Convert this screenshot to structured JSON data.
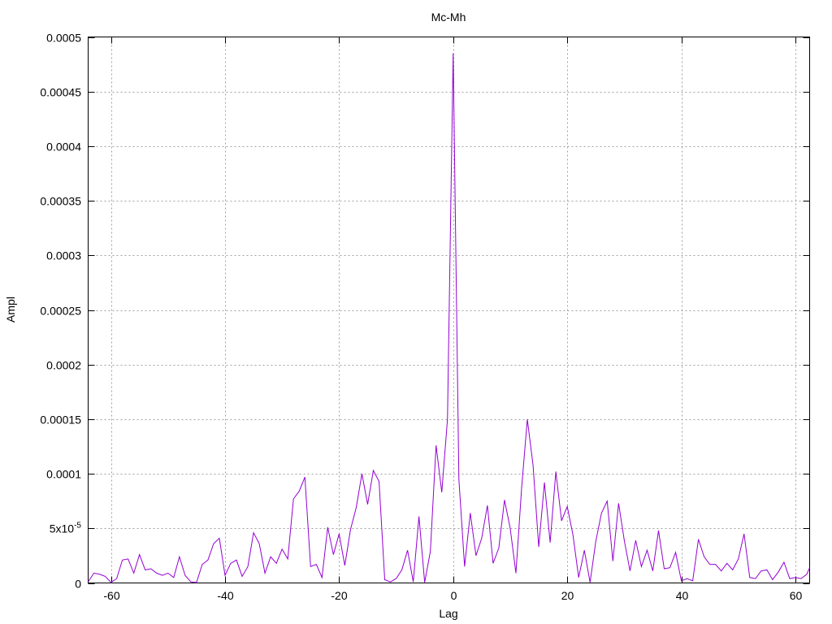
{
  "chart_data": {
    "type": "line",
    "title": "Mc-Mh",
    "xlabel": "Lag",
    "ylabel": "Ampl",
    "xlim": [
      -64,
      62.5
    ],
    "ylim": [
      0,
      0.0005
    ],
    "grid": true,
    "x_ticks": [
      -60,
      -40,
      -20,
      0,
      20,
      40,
      60
    ],
    "x_tick_labels": [
      "-60",
      "-40",
      "-20",
      "0",
      "20",
      "40",
      "60"
    ],
    "y_ticks": [
      0,
      5e-05,
      0.0001,
      0.00015,
      0.0002,
      0.00025,
      0.0003,
      0.00035,
      0.0004,
      0.00045,
      0.0005
    ],
    "y_tick_labels": [
      "0",
      "5x10",
      "0.0001",
      "0.00015",
      "0.0002",
      "0.00025",
      "0.0003",
      "0.00035",
      "0.0004",
      "0.00045",
      "0.0005"
    ],
    "y_tick_exponent": "-5",
    "line_color": "#9400d3",
    "series": [
      {
        "x": [
          -64,
          -63,
          -62,
          -61,
          -60,
          -59,
          -58,
          -57,
          -56,
          -55,
          -54,
          -53,
          -52,
          -51,
          -50,
          -49,
          -48,
          -47,
          -46,
          -45,
          -44,
          -43,
          -42,
          -41,
          -40,
          -39,
          -38,
          -37,
          -36,
          -35,
          -34,
          -33,
          -32,
          -31,
          -30,
          -29,
          -28,
          -27,
          -26,
          -25,
          -24,
          -23,
          -22,
          -21,
          -20,
          -19,
          -18,
          -17,
          -16,
          -15,
          -14,
          -13,
          -12,
          -11,
          -10,
          -9,
          -8,
          -7,
          -6,
          -5,
          -4,
          -3,
          -2,
          -1,
          0,
          1,
          2,
          3,
          4,
          5,
          6,
          7,
          8,
          9,
          10,
          11,
          12,
          13,
          14,
          15,
          16,
          17,
          18,
          19,
          20,
          21,
          22,
          23,
          24,
          25,
          26,
          27,
          28,
          29,
          30,
          31,
          32,
          33,
          34,
          35,
          36,
          37,
          38,
          39,
          40,
          41,
          42,
          43,
          44,
          45,
          46,
          47,
          48,
          49,
          50,
          51,
          52,
          53,
          54,
          55,
          56,
          57,
          58,
          59,
          60,
          61,
          62,
          62.5
        ],
        "y": [
          1e-06,
          9e-06,
          8e-06,
          6e-06,
          5e-07,
          4e-06,
          2.1e-05,
          2.2e-05,
          9e-06,
          2.6e-05,
          1.2e-05,
          1.3e-05,
          9e-06,
          7e-06,
          9e-06,
          5e-06,
          2.4e-05,
          7e-06,
          1e-06,
          5e-07,
          1.7e-05,
          2.1e-05,
          3.6e-05,
          4.1e-05,
          7e-06,
          1.8e-05,
          2.1e-05,
          6e-06,
          1.5e-05,
          4.6e-05,
          3.6e-05,
          9e-06,
          2.4e-05,
          1.8e-05,
          3.1e-05,
          2.2e-05,
          7.7e-05,
          8.4e-05,
          9.7e-05,
          1.5e-05,
          1.7e-05,
          5e-06,
          5.1e-05,
          2.6e-05,
          4.5e-05,
          1.6e-05,
          4.9e-05,
          6.9e-05,
          0.0001,
          7.2e-05,
          0.000103,
          9.3e-05,
          3e-06,
          1e-06,
          4e-06,
          1.2e-05,
          3e-05,
          1e-06,
          6.1e-05,
          5e-07,
          2.9e-05,
          0.000126,
          8.3e-05,
          0.00015,
          0.000485,
          9.5e-05,
          1.5e-05,
          6.4e-05,
          2.5e-05,
          4.1e-05,
          7.1e-05,
          1.8e-05,
          3.2e-05,
          7.6e-05,
          5e-05,
          9e-06,
          8.7e-05,
          0.00015,
          0.000108,
          3.3e-05,
          9.2e-05,
          3.7e-05,
          0.000102,
          5.7e-05,
          7e-05,
          4.4e-05,
          5e-06,
          3e-05,
          5e-07,
          3.8e-05,
          6.4e-05,
          7.5e-05,
          2e-05,
          7.3e-05,
          3.9e-05,
          1.1e-05,
          3.9e-05,
          1.5e-05,
          3e-05,
          1.1e-05,
          4.8e-05,
          1.3e-05,
          1.4e-05,
          2.8e-05,
          2e-06,
          4e-06,
          2e-06,
          4e-05,
          2.4e-05,
          1.7e-05,
          1.7e-05,
          1.1e-05,
          1.8e-05,
          1.2e-05,
          2.2e-05,
          4.5e-05,
          5e-06,
          4e-06,
          1.1e-05,
          1.2e-05,
          3e-06,
          1e-05,
          1.9e-05,
          4e-06,
          5e-06,
          4e-06,
          8e-06,
          1.4e-05
        ]
      }
    ]
  }
}
